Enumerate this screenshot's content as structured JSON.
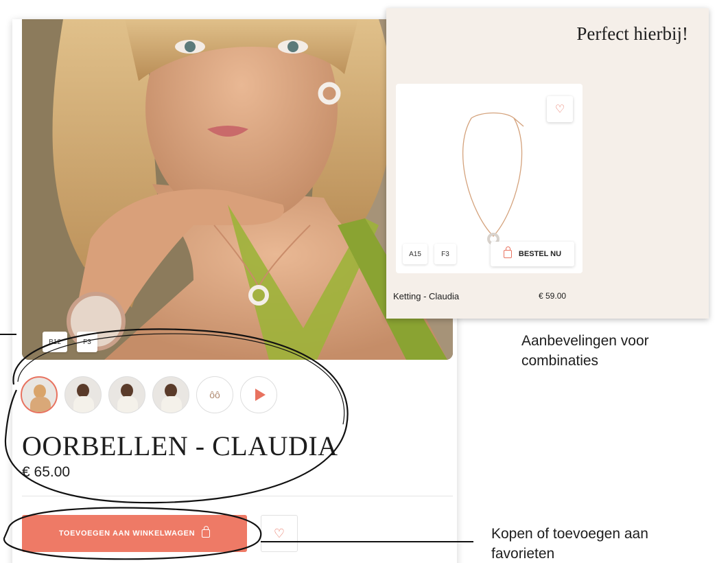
{
  "product": {
    "tags": [
      "B12",
      "F3"
    ],
    "title": "OORBELLEN - CLAUDIA",
    "price": "€ 65.00",
    "add_to_cart_label": "TOEVOEGEN AAN WINKELWAGEN",
    "thumbnails": [
      "model-photo-1",
      "model-photo-2",
      "model-photo-3",
      "model-photo-4",
      "earrings-photo",
      "video"
    ],
    "wishlist_icon": "heart-icon"
  },
  "recommendation": {
    "heading": "Perfect hierbij!",
    "tags": [
      "A15",
      "F3"
    ],
    "buy_label": "BESTEL NU",
    "name": "Ketting - Claudia",
    "price": "€ 59.00"
  },
  "annotations": {
    "combinations": "Aanbevelingen voor combinaties",
    "buy_or_wishlist": "Kopen of toevoegen aan favorieten"
  },
  "colors": {
    "accent": "#ee7a66",
    "panel_bg": "#f5efe9"
  }
}
